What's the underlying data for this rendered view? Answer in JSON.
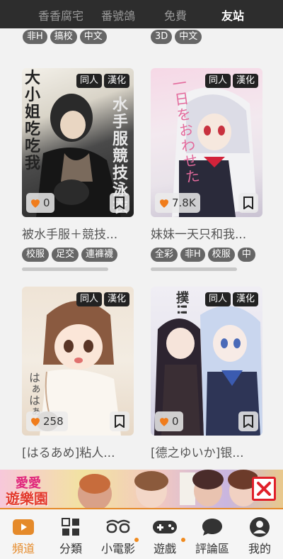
{
  "top_tabs": [
    {
      "label": "香香腐宅",
      "active": false
    },
    {
      "label": "番號鴿",
      "active": false
    },
    {
      "label": "免費",
      "active": false
    },
    {
      "label": "友站",
      "active": true
    }
  ],
  "prev_tags_left": [
    "非H",
    "搞校",
    "中文"
  ],
  "prev_tags_right": [
    "3D",
    "中文"
  ],
  "cards": [
    {
      "badges": [
        "同人",
        "漢化"
      ],
      "likes": "0",
      "title": "被水手服＋競技...",
      "tags": [
        "校服",
        "足交",
        "連褲襪"
      ],
      "cover_text": "大小姐吃吃我",
      "cover_text2": "水手服競技泳衣"
    },
    {
      "badges": [
        "同人",
        "漢化"
      ],
      "likes": "7.8K",
      "title": "妹妹一天只和我...",
      "tags": [
        "全彩",
        "非H",
        "校服",
        "中"
      ],
      "cover_text": "一日をおわせた"
    },
    {
      "badges": [
        "同人",
        "漢化"
      ],
      "likes": "258",
      "title": "[はるあめ]粘人...",
      "tags": [],
      "cover_text": "はぁはぁ"
    },
    {
      "badges": [
        "同人",
        "漢化"
      ],
      "likes": "0",
      "title": "[德之ゆいか]银...",
      "tags": [],
      "cover_text": "撲!!"
    }
  ],
  "ad": {
    "line1": "愛愛",
    "line2": "遊樂園"
  },
  "bottom_nav": [
    {
      "label": "頻道",
      "icon": "play-icon",
      "active": true,
      "dot": false
    },
    {
      "label": "分類",
      "icon": "grid-icon",
      "active": false,
      "dot": false
    },
    {
      "label": "小電影",
      "icon": "glasses-icon",
      "active": false,
      "dot": true
    },
    {
      "label": "遊戲",
      "icon": "gamepad-icon",
      "active": false,
      "dot": true
    },
    {
      "label": "評論區",
      "icon": "chat-icon",
      "active": false,
      "dot": false
    },
    {
      "label": "我的",
      "icon": "user-icon",
      "active": false,
      "dot": false
    }
  ],
  "colors": {
    "accent": "#e58a2a",
    "topbar": "#2d2d2d",
    "heart": "#f07c1b"
  }
}
